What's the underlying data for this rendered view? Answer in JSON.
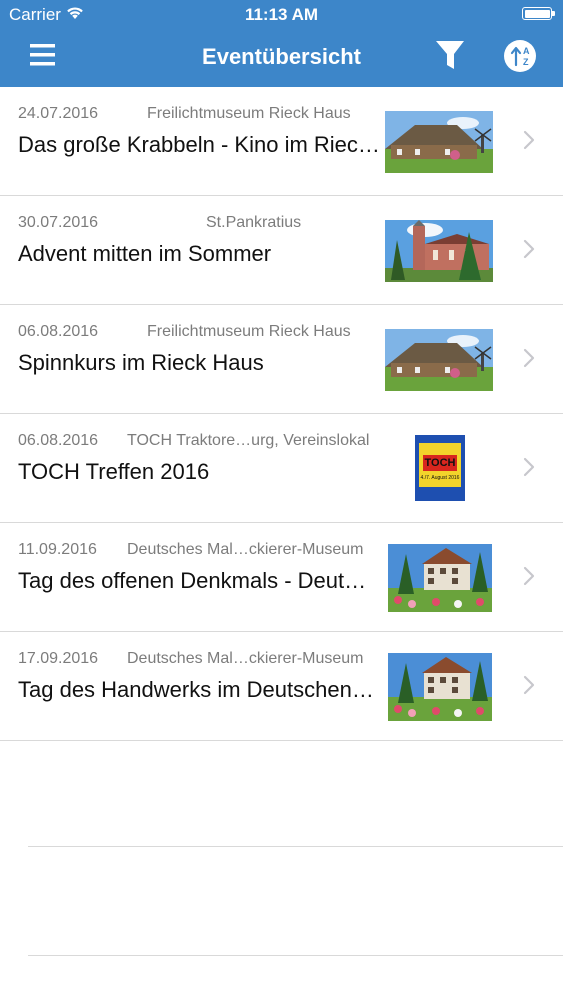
{
  "status_bar": {
    "carrier": "Carrier",
    "time": "11:13 AM"
  },
  "nav": {
    "title": "Eventübersicht"
  },
  "events": [
    {
      "date": "24.07.2016",
      "venue": "Freilichtmuseum Rieck Haus",
      "title": "Das große Krabbeln - Kino im Riec…",
      "thumb": "rieck-haus-photo"
    },
    {
      "date": "30.07.2016",
      "venue": "St.Pankratius",
      "title": "Advent mitten im Sommer",
      "thumb": "church-photo"
    },
    {
      "date": "06.08.2016",
      "venue": "Freilichtmuseum Rieck Haus",
      "title": "Spinnkurs im Rieck Haus",
      "thumb": "rieck-haus-photo"
    },
    {
      "date": "06.08.2016",
      "venue": "TOCH Traktore…urg, Vereinslokal",
      "title": "TOCH Treffen 2016",
      "thumb": "toch-poster",
      "poster_text": "TOCH",
      "poster_sub": "4./7. August 2016"
    },
    {
      "date": "11.09.2016",
      "venue": "Deutsches Mal…ckierer-Museum",
      "title": "Tag des offenen Denkmals - Deut…",
      "thumb": "museum-photo"
    },
    {
      "date": "17.09.2016",
      "venue": "Deutsches Mal…ckierer-Museum",
      "title": "Tag des Handwerks im Deutschen…",
      "thumb": "museum-photo"
    }
  ],
  "colors": {
    "header": "#3d86c9",
    "separator": "#d9d9d9",
    "meta_text": "#7c7c7c",
    "chevron": "#c7c7cc"
  }
}
